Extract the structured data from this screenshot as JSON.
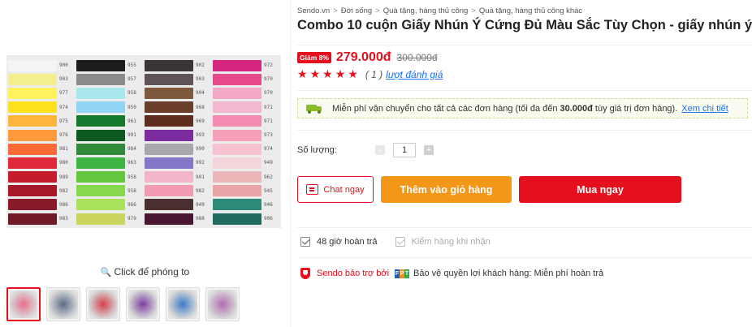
{
  "gallery": {
    "zoom_hint": "Click để phóng to",
    "zoom_icon": "magnifier-icon",
    "swatch_columns": [
      {
        "colors": [
          "#f4f4f2",
          "#f3ee8e",
          "#fff35d",
          "#ffe21c",
          "#ffb53a",
          "#ff9a3c",
          "#ff6b37",
          "#e0293a",
          "#c51b2c",
          "#a6182a",
          "#881a2a",
          "#6f1a26"
        ],
        "numbers": [
          "900",
          "903",
          "977",
          "974",
          "975",
          "976",
          "981",
          "980",
          "989",
          "982",
          "986",
          "983"
        ]
      },
      {
        "colors": [
          "#1c1c1c",
          "#8a8a8a",
          "#a8e7ec",
          "#8fd4f2",
          "#157a2d",
          "#0f5a22",
          "#2f8a3a",
          "#3fb544",
          "#62c73c",
          "#86d94c",
          "#a8e25b",
          "#c9d55c"
        ],
        "numbers": [
          "955",
          "957",
          "958",
          "959",
          "961",
          "991",
          "984",
          "963",
          "958",
          "958",
          "966",
          "979"
        ]
      },
      {
        "colors": [
          "#3a3434",
          "#5e5656",
          "#7d5a3d",
          "#6b3e2c",
          "#5d2e1e",
          "#7b2d9f",
          "#a8a8ad",
          "#8577c8",
          "#f3b6c8",
          "#f29bb2",
          "#4b2f2f",
          "#4a1730"
        ],
        "numbers": [
          "902",
          "903",
          "904",
          "968",
          "969",
          "993",
          "990",
          "992",
          "901",
          "982",
          "949",
          "988"
        ]
      },
      {
        "colors": [
          "#d7267f",
          "#e84a8e",
          "#f3a9c6",
          "#f2b8cf",
          "#f28ab1",
          "#f5a0b8",
          "#f6c2cf",
          "#f3d6db",
          "#ebb7b8",
          "#e9a4a8",
          "#2b8a78",
          "#1f6b5f"
        ],
        "numbers": [
          "972",
          "970",
          "970",
          "971",
          "971",
          "973",
          "974",
          "949",
          "962",
          "945",
          "946",
          "906"
        ]
      }
    ],
    "thumbnails": [
      {
        "name": "thumbnail-1",
        "color": "#e86d8b",
        "active": true
      },
      {
        "name": "thumbnail-2",
        "color": "#5a6b86",
        "active": false
      },
      {
        "name": "thumbnail-3",
        "color": "#d23f4c",
        "active": false
      },
      {
        "name": "thumbnail-4",
        "color": "#7c3fa2",
        "active": false
      },
      {
        "name": "thumbnail-5",
        "color": "#3b7bc8",
        "active": false
      },
      {
        "name": "thumbnail-6",
        "color": "#b06bb0",
        "active": false
      }
    ]
  },
  "breadcrumb": [
    "Sendo.vn",
    "Đời sống",
    "Quà tặng, hàng thủ công",
    "Quà tặng, hàng thủ công khác"
  ],
  "product": {
    "title": "Combo 10 cuộn Giấy Nhún Ý Cứng Đủ Màu Sắc Tùy Chọn - giấy nhún ý",
    "discount_badge": "Giảm 8%",
    "price": "279.000đ",
    "old_price": "300.000đ",
    "rating_stars": 5,
    "rating_count": "( 1 )",
    "rating_link": "lượt đánh giá"
  },
  "shipping": {
    "icon": "truck-icon",
    "text_before": "Miễn phí vận chuyển cho tất cả các đơn hàng (tối đa đến",
    "amount": "30.000đ",
    "text_after": "tùy giá trị đơn hàng).",
    "link": "Xem chi tiết"
  },
  "quantity": {
    "label": "Số lượng:",
    "value": "1",
    "minus_label": "-",
    "plus_label": "+"
  },
  "actions": {
    "chat_label": "Chat ngay",
    "chat_icon": "chat-icon",
    "add_to_cart_label": "Thêm vào giỏ hàng",
    "buy_now_label": "Mua ngay"
  },
  "guarantees": {
    "return_label": "48 giờ hoàn trả",
    "inspect_label": "Kiểm hàng khi nhận"
  },
  "sponsor": {
    "label": "Sendo bảo trợ bởi",
    "partner_logo": "FPT",
    "description": "Bảo vệ quyền lợi khách hàng: Miễn phí hoàn trả"
  },
  "colors": {
    "brand_red": "#e5101d",
    "cart_orange": "#f39719",
    "link_blue": "#1a73e8",
    "shipping_green": "#8bbd2b"
  }
}
